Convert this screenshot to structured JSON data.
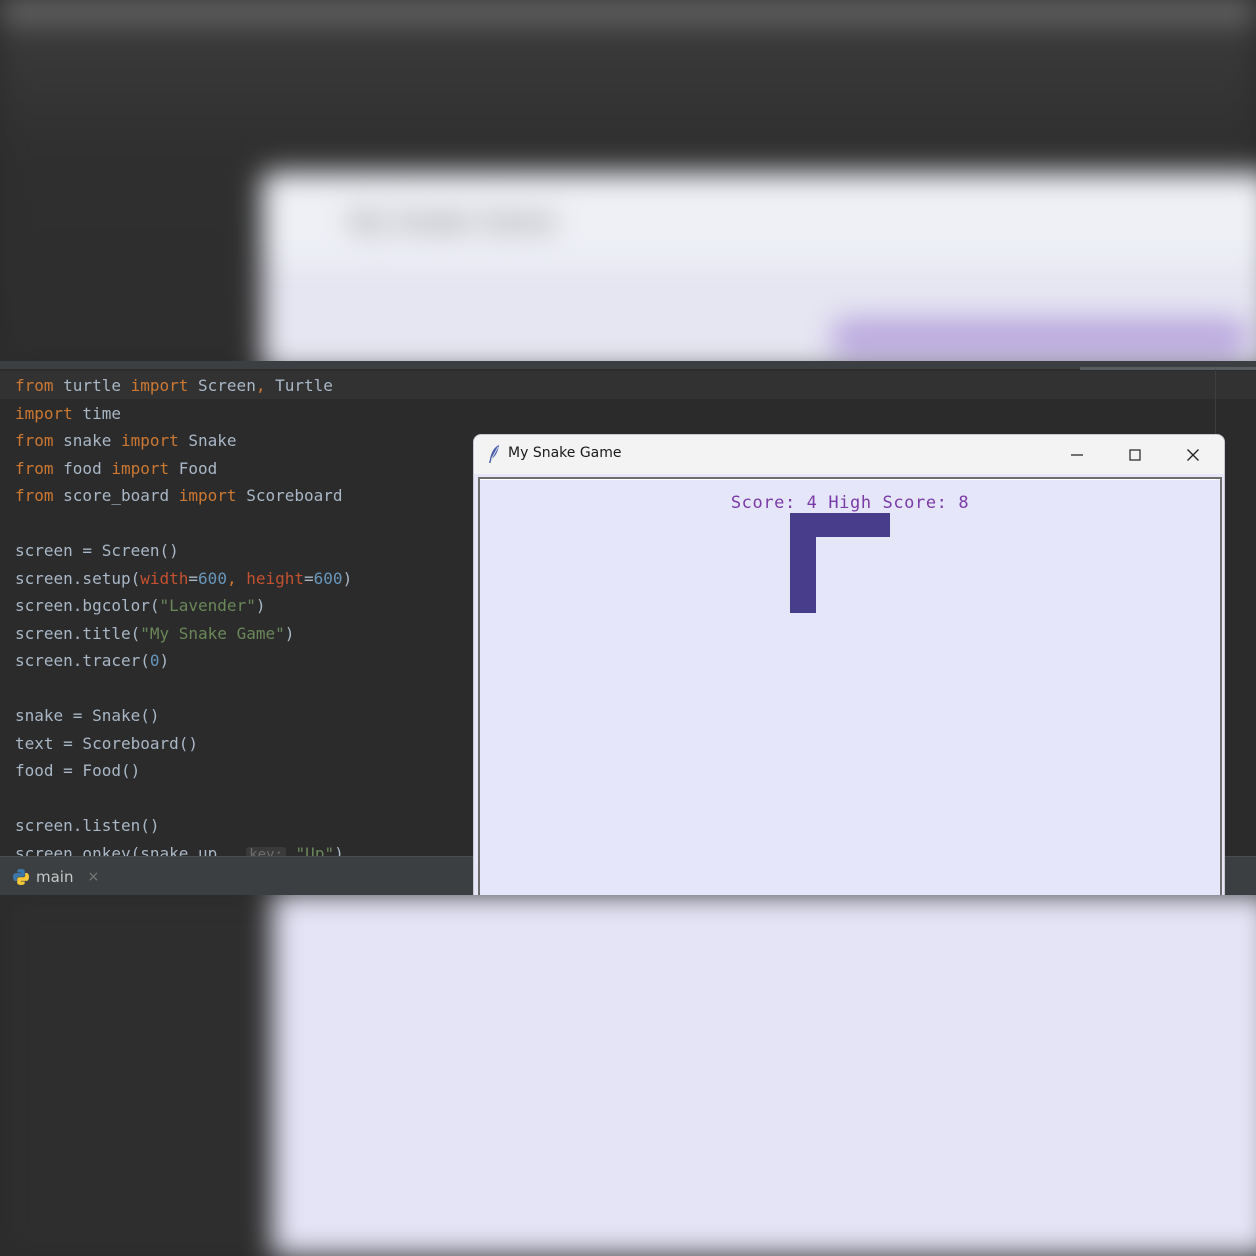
{
  "editor": {
    "lines": [
      [
        {
          "t": "from",
          "c": "kw"
        },
        {
          "t": " turtle "
        },
        {
          "t": "import",
          "c": "kw"
        },
        {
          "t": " Screen"
        },
        {
          "t": ",",
          "c": "kw"
        },
        {
          "t": " Turtle"
        }
      ],
      [
        {
          "t": "import",
          "c": "kw"
        },
        {
          "t": " time"
        }
      ],
      [
        {
          "t": "from",
          "c": "kw"
        },
        {
          "t": " snake "
        },
        {
          "t": "import",
          "c": "kw"
        },
        {
          "t": " Snake"
        }
      ],
      [
        {
          "t": "from",
          "c": "kw"
        },
        {
          "t": " food "
        },
        {
          "t": "import",
          "c": "kw"
        },
        {
          "t": " Food"
        }
      ],
      [
        {
          "t": "from",
          "c": "kw"
        },
        {
          "t": " score_board "
        },
        {
          "t": "import",
          "c": "kw"
        },
        {
          "t": " Scoreboard"
        }
      ],
      [],
      [
        {
          "t": "screen = Screen()"
        }
      ],
      [
        {
          "t": "screen.setup("
        },
        {
          "t": "width",
          "c": "param"
        },
        {
          "t": "="
        },
        {
          "t": "600",
          "c": "num"
        },
        {
          "t": ", ",
          "c": "kw"
        },
        {
          "t": "height",
          "c": "param"
        },
        {
          "t": "="
        },
        {
          "t": "600",
          "c": "num"
        },
        {
          "t": ")"
        }
      ],
      [
        {
          "t": "screen.bgcolor("
        },
        {
          "t": "\"Lavender\"",
          "c": "str"
        },
        {
          "t": ")"
        }
      ],
      [
        {
          "t": "screen.title("
        },
        {
          "t": "\"My Snake Game\"",
          "c": "str"
        },
        {
          "t": ")"
        }
      ],
      [
        {
          "t": "screen.tracer("
        },
        {
          "t": "0",
          "c": "num"
        },
        {
          "t": ")"
        }
      ],
      [],
      [
        {
          "t": "snake = Snake()"
        }
      ],
      [
        {
          "t": "text = Scoreboard()"
        }
      ],
      [
        {
          "t": "food = Food()"
        }
      ],
      [],
      [
        {
          "t": "screen.listen()"
        }
      ],
      [
        {
          "t": "screen.onkey(snake.up,  "
        },
        {
          "t": "key:",
          "c": "hint"
        },
        {
          "t": " "
        },
        {
          "t": "\"Up\"",
          "c": "str"
        },
        {
          "t": ")"
        }
      ]
    ]
  },
  "tabbar": {
    "tab_label": "main",
    "close_glyph": "×"
  },
  "turtle_window": {
    "title": "My Snake Game",
    "score_text": "Score: 4 High Score: 8",
    "canvas_bg": "#E6E6FA",
    "snake_color": "#483D8B"
  },
  "background": {
    "blurred_title": "My Snake Game"
  }
}
